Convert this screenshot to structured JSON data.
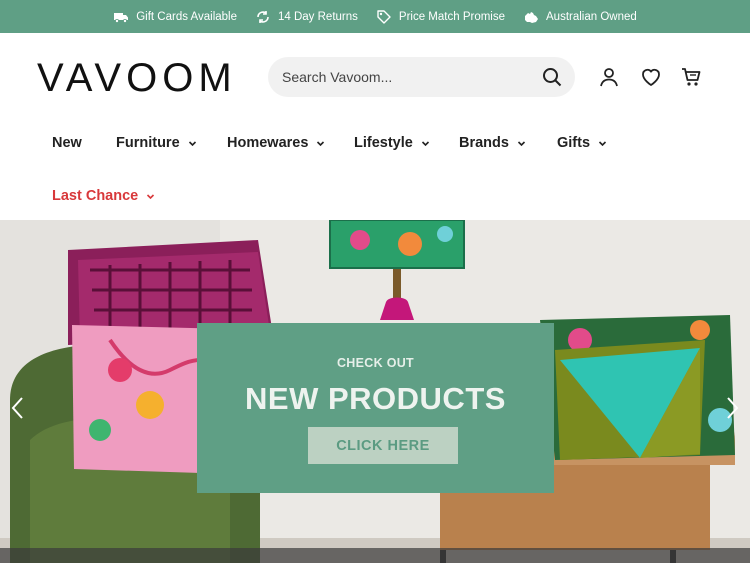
{
  "announcement": {
    "items": [
      {
        "label": "Gift Cards Available",
        "icon": "truck-icon"
      },
      {
        "label": "14 Day Returns",
        "icon": "returns-icon"
      },
      {
        "label": "Price Match Promise",
        "icon": "price-tag-icon"
      },
      {
        "label": "Australian Owned",
        "icon": "australia-icon"
      }
    ]
  },
  "header": {
    "logo_text": "VAVOOM",
    "search_placeholder": "Search Vavoom...",
    "icons": [
      "account-icon",
      "wishlist-heart-icon",
      "cart-icon"
    ]
  },
  "nav": {
    "items": [
      {
        "label": "New",
        "has_dropdown": false
      },
      {
        "label": "Furniture",
        "has_dropdown": true
      },
      {
        "label": "Homewares",
        "has_dropdown": true
      },
      {
        "label": "Lifestyle",
        "has_dropdown": true
      },
      {
        "label": "Brands",
        "has_dropdown": true
      },
      {
        "label": "Gifts",
        "has_dropdown": true
      },
      {
        "label": "Last Chance",
        "has_dropdown": true,
        "highlight_color": "#d8383a"
      }
    ]
  },
  "hero": {
    "eyebrow": "CHECK OUT",
    "headline": "NEW PRODUCTS",
    "cta_label": "CLICK HERE",
    "prev_icon": "chevron-left-icon",
    "next_icon": "chevron-right-icon"
  },
  "colors": {
    "brand_green": "#5f9f85",
    "cta_bg": "#bcd1c2",
    "sale_red": "#d8383a"
  }
}
